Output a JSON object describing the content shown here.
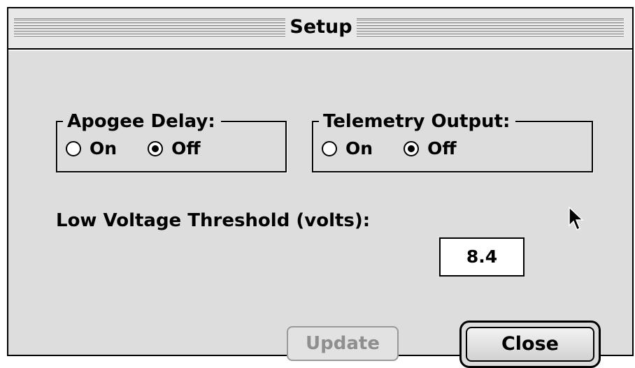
{
  "window": {
    "title": "Setup"
  },
  "apogee_delay": {
    "title": "Apogee Delay:",
    "options": [
      {
        "label": "On",
        "selected": false
      },
      {
        "label": "Off",
        "selected": true
      }
    ]
  },
  "telemetry_output": {
    "title": "Telemetry Output:",
    "options": [
      {
        "label": "On",
        "selected": false
      },
      {
        "label": "Off",
        "selected": true
      }
    ]
  },
  "low_voltage": {
    "label": "Low Voltage Threshold (volts):",
    "value": "8.4"
  },
  "buttons": {
    "update": {
      "label": "Update",
      "enabled": false
    },
    "close": {
      "label": "Close",
      "default": true
    }
  },
  "cursor": {
    "icon": "arrow-pointer-icon"
  }
}
